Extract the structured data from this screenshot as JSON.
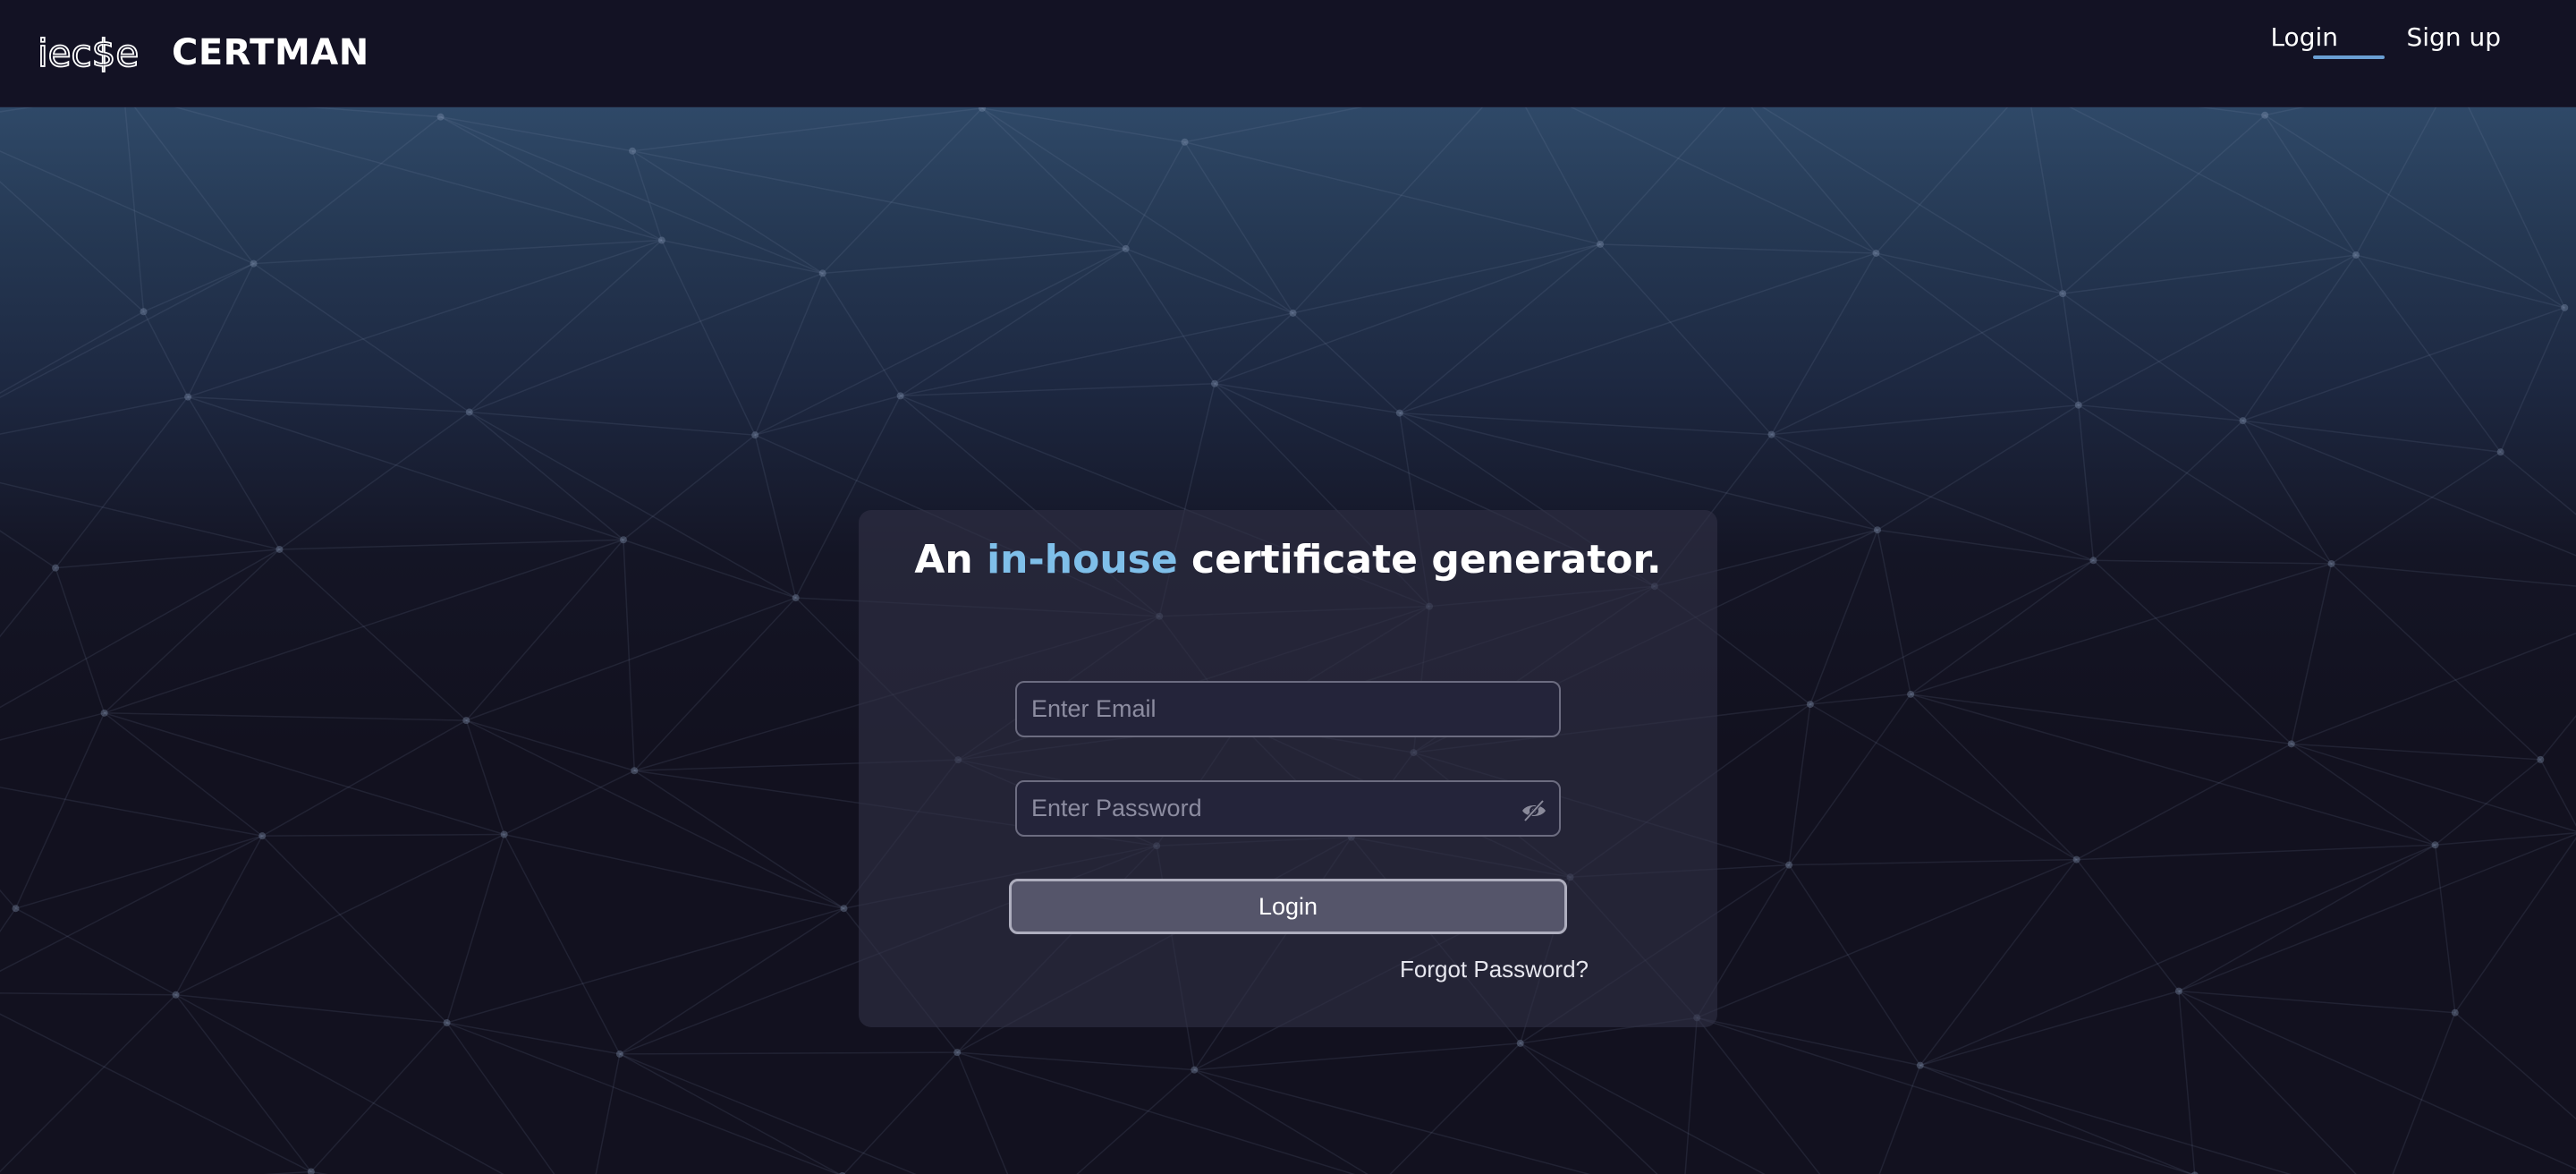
{
  "header": {
    "logo_text": "iec$e",
    "app_name": "CERTMAN",
    "nav": [
      {
        "label": "Login",
        "active": true
      },
      {
        "label": "Sign up",
        "active": false
      }
    ]
  },
  "login_card": {
    "title_prefix": "An",
    "title_highlight": "in-house",
    "title_suffix": "certificate generator.",
    "email_placeholder": "Enter Email",
    "password_placeholder": "Enter Password",
    "password_toggle_icon": "eye-off-icon",
    "submit_label": "Login",
    "forgot_label": "Forgot Password?"
  },
  "colors": {
    "accent": "#7fbfe9",
    "nav_underline": "#6a9fd4",
    "background": "#12111f",
    "card": "#303046"
  }
}
